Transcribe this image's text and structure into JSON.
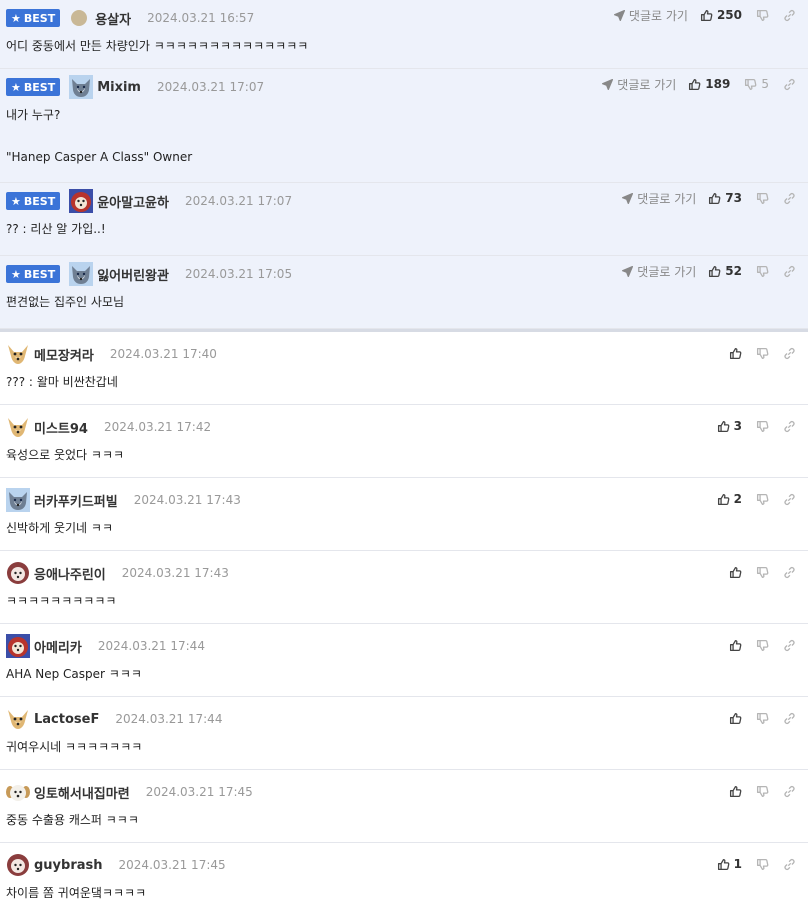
{
  "labels": {
    "best": "BEST",
    "reply_link": "댓글로 가기"
  },
  "colors": {
    "best_badge": "#3b74d8",
    "best_row_bg": "#eef2fb",
    "divider": "#e4e6ec"
  },
  "best_comments": [
    {
      "nick": "용살자",
      "time": "2024.03.21 16:57",
      "lines": [
        "어디 중동에서 만든 차량인가 ㅋㅋㅋㅋㅋㅋㅋㅋㅋㅋㅋㅋㅋㅋ"
      ],
      "up": "250",
      "down": "",
      "avatar": "dot"
    },
    {
      "nick": "Mixim",
      "time": "2024.03.21 17:07",
      "lines": [
        "내가 누구?",
        "",
        "\"Hanep Casper A Class\" Owner"
      ],
      "up": "189",
      "down": "5",
      "avatar": "husky"
    },
    {
      "nick": "윤아말고윤하",
      "time": "2024.03.21 17:07",
      "lines": [
        "?? : 리산 알 가입..!"
      ],
      "up": "73",
      "down": "",
      "avatar": "red"
    },
    {
      "nick": "잃어버린왕관",
      "time": "2024.03.21 17:05",
      "lines": [
        "편견없는 집주인 사모님"
      ],
      "up": "52",
      "down": "",
      "avatar": "husky"
    }
  ],
  "comments": [
    {
      "nick": "메모장켜라",
      "time": "2024.03.21 17:40",
      "text": "??? : 왈마 비싼찬갑네",
      "up": "",
      "down": "",
      "avatar": "chihuahua"
    },
    {
      "nick": "미스트94",
      "time": "2024.03.21 17:42",
      "text": "육성으로 웃었다 ㅋㅋㅋ",
      "up": "3",
      "down": "",
      "avatar": "chihuahua"
    },
    {
      "nick": "러카푸키드퍼빌",
      "time": "2024.03.21 17:43",
      "text": "신박하게 웃기네 ㅋㅋ",
      "up": "2",
      "down": "",
      "avatar": "husky"
    },
    {
      "nick": "응애나주린이",
      "time": "2024.03.21 17:43",
      "text": "ㅋㅋㅋㅋㅋㅋㅋㅋㅋㅋ",
      "up": "",
      "down": "",
      "avatar": "pink"
    },
    {
      "nick": "아메리카",
      "time": "2024.03.21 17:44",
      "text": "AHA Nep Casper ㅋㅋㅋ",
      "up": "",
      "down": "",
      "avatar": "red"
    },
    {
      "nick": "LactoseF",
      "time": "2024.03.21 17:44",
      "text": "귀여우시네 ㅋㅋㅋㅋㅋㅋㅋ",
      "up": "",
      "down": "",
      "avatar": "chihuahua"
    },
    {
      "nick": "잉토해서내집마련",
      "time": "2024.03.21 17:45",
      "text": "중동 수출용 캐스퍼 ㅋㅋㅋ",
      "up": "",
      "down": "",
      "avatar": "puppy"
    },
    {
      "nick": "guybrash",
      "time": "2024.03.21 17:45",
      "text": "차이름 쫌 귀여운댘ㅋㅋㅋㅋ",
      "up": "1",
      "down": "",
      "avatar": "pink"
    }
  ]
}
